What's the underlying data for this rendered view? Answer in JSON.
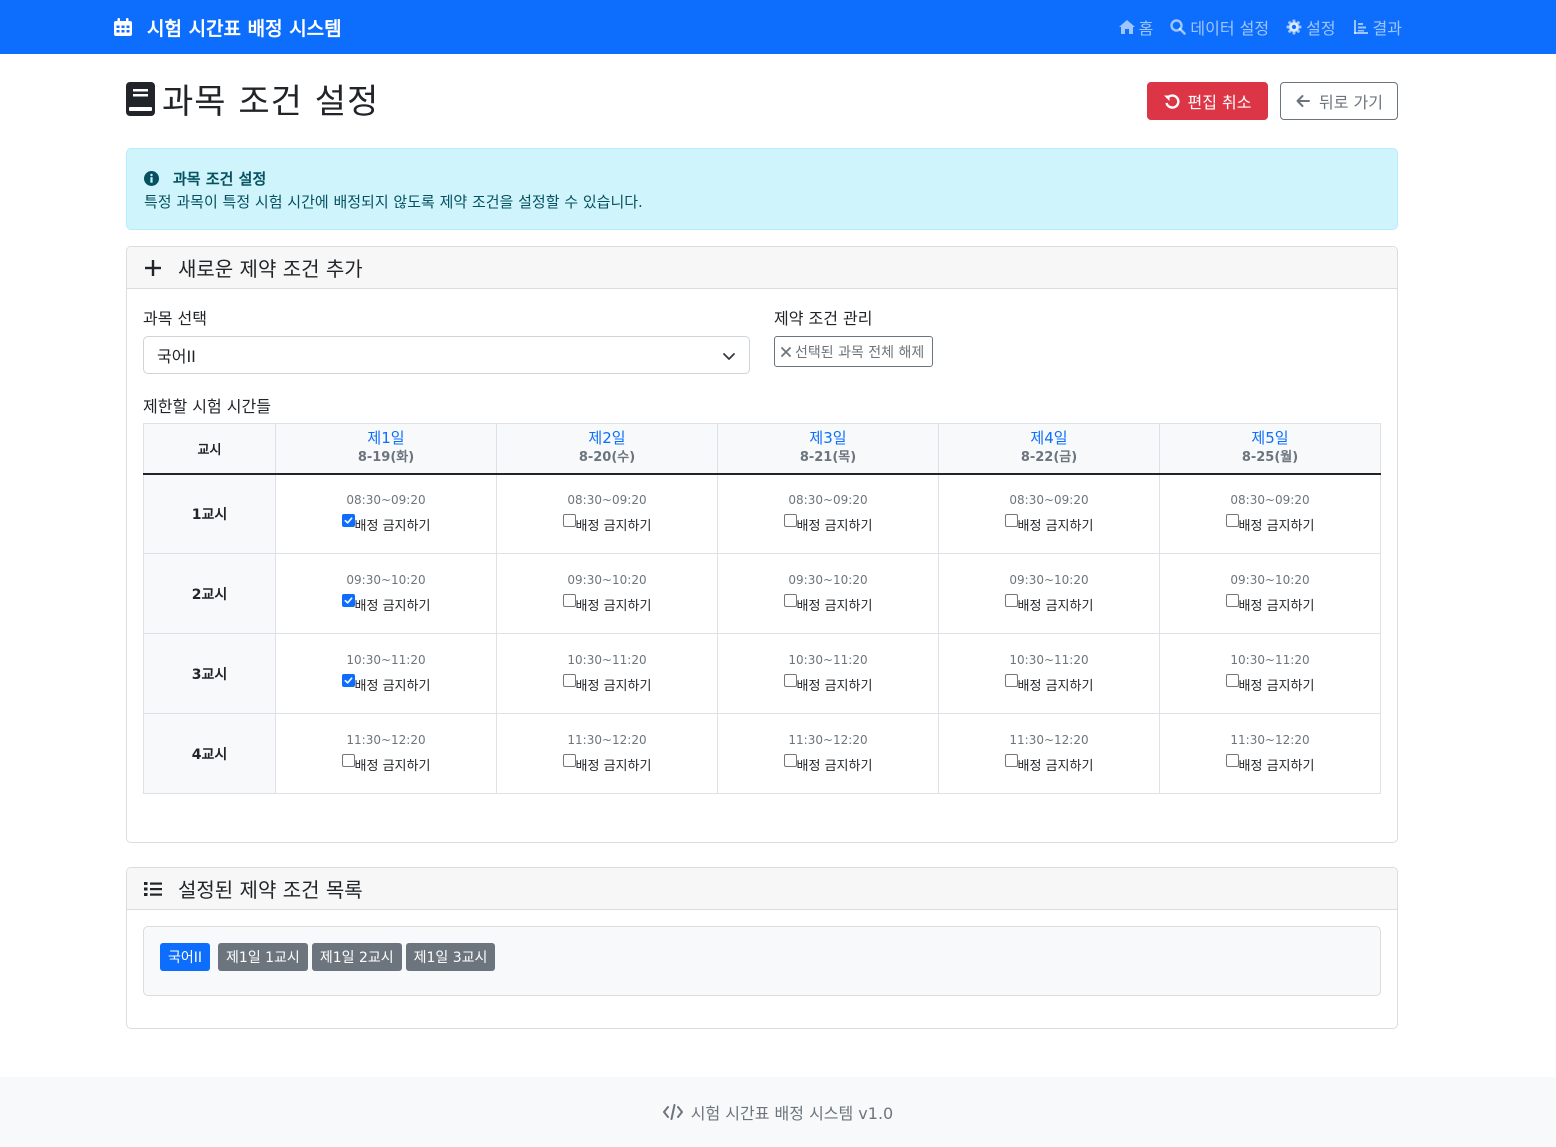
{
  "navbar": {
    "brand": "시험 시간표 배정 시스템",
    "links": [
      {
        "icon": "home-icon",
        "label": "홈"
      },
      {
        "icon": "search-icon",
        "label": "데이터 설정"
      },
      {
        "icon": "gear-icon",
        "label": "설정"
      },
      {
        "icon": "chart-icon",
        "label": "결과"
      }
    ]
  },
  "page": {
    "title": "과목 조건 설정",
    "cancel_edit_label": "편집 취소",
    "back_label": "뒤로 가기"
  },
  "alert": {
    "title": "과목 조건 설정",
    "text": "특정 과목이 특정 시험 시간에 배정되지 않도록 제약 조건을 설정할 수 있습니다."
  },
  "add_card": {
    "header": "새로운 제약 조건 추가",
    "subject_label": "과목 선택",
    "subject_value": "국어II",
    "manage_label": "제약 조건 관리",
    "clear_button": "선택된 과목 전체 해제",
    "times_label": "제한할 시험 시간들",
    "period_header": "교시",
    "checkbox_label": "배정 금지하기",
    "days": [
      {
        "name": "제1일",
        "date": "8-19(화)"
      },
      {
        "name": "제2일",
        "date": "8-20(수)"
      },
      {
        "name": "제3일",
        "date": "8-21(목)"
      },
      {
        "name": "제4일",
        "date": "8-22(금)"
      },
      {
        "name": "제5일",
        "date": "8-25(월)"
      }
    ],
    "periods": [
      {
        "name": "1교시",
        "time": "08:30~09:20",
        "checked": [
          true,
          false,
          false,
          false,
          false
        ]
      },
      {
        "name": "2교시",
        "time": "09:30~10:20",
        "checked": [
          true,
          false,
          false,
          false,
          false
        ]
      },
      {
        "name": "3교시",
        "time": "10:30~11:20",
        "checked": [
          true,
          false,
          false,
          false,
          false
        ]
      },
      {
        "name": "4교시",
        "time": "11:30~12:20",
        "checked": [
          false,
          false,
          false,
          false,
          false
        ]
      }
    ]
  },
  "list_card": {
    "header": "설정된 제약 조건 목록",
    "subject_badge": "국어II",
    "constraints": [
      "제1일 1교시",
      "제1일 2교시",
      "제1일 3교시"
    ]
  },
  "footer": {
    "text": "시험 시간표 배정 시스템 v1.0"
  }
}
